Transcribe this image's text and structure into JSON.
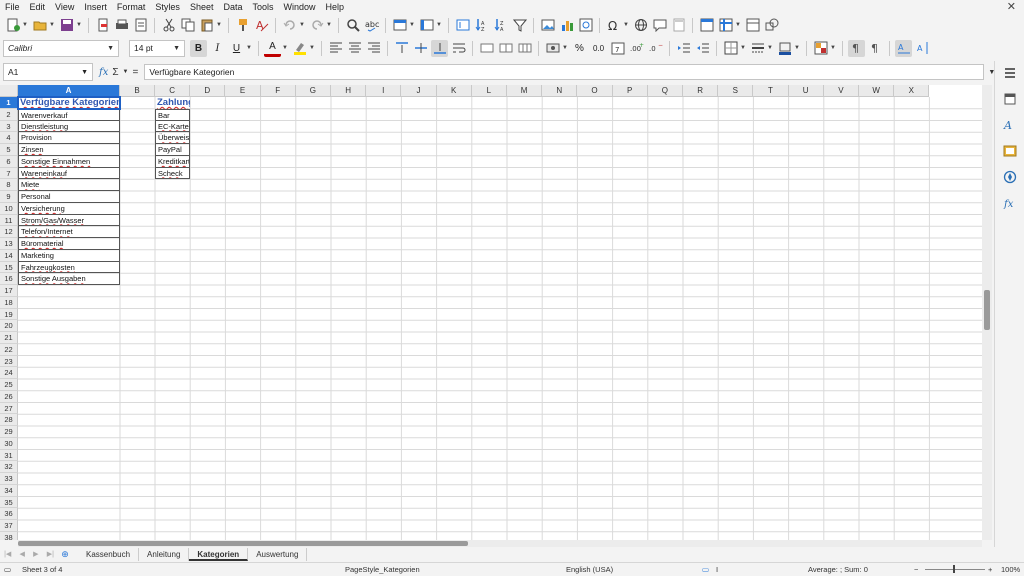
{
  "menu": [
    "File",
    "Edit",
    "View",
    "Insert",
    "Format",
    "Styles",
    "Sheet",
    "Data",
    "Tools",
    "Window",
    "Help"
  ],
  "close_glyph": "✕",
  "font": {
    "name": "Calibri",
    "size": "14 pt"
  },
  "format_buttons": {
    "bold": "B",
    "italic": "I",
    "underline": "U",
    "font_color": "A",
    "percent": "%",
    "decimals": "0.0"
  },
  "namebox": "A1",
  "formula": "Verfügbare Kategorien",
  "formula_symbols": {
    "fx": "fx",
    "sum": "Σ",
    "equals": "="
  },
  "columns": [
    "A",
    "B",
    "C",
    "D",
    "E",
    "F",
    "G",
    "H",
    "I",
    "J",
    "K",
    "L",
    "M",
    "N",
    "O",
    "P",
    "Q",
    "R",
    "S",
    "T",
    "U",
    "V",
    "W",
    "X"
  ],
  "row_count": 38,
  "cells": {
    "A1": "Verfügbare Kategorien",
    "C1": "Zahlungsarten",
    "A": [
      "Warenverkauf",
      "Dienstleistung",
      "Provision",
      "Zinsen",
      "Sonstige Einnahmen",
      "Wareneinkauf",
      "Miete",
      "Personal",
      "Versicherung",
      "Strom/Gas/Wasser",
      "Telefon/Internet",
      "Büromaterial",
      "Marketing",
      "Fahrzeugkosten",
      "Sonstige Ausgaben"
    ],
    "C": [
      "Bar",
      "EC-Karte",
      "Überweisung",
      "PayPal",
      "Kreditkarte",
      "Scheck"
    ]
  },
  "sheet_tabs": [
    "Kassenbuch",
    "Anleitung",
    "Kategorien",
    "Auswertung"
  ],
  "active_tab": "Kategorien",
  "status": {
    "sheet": "Sheet 3 of 4",
    "page_style": "PageStyle_Kategorien",
    "language": "English (USA)",
    "summary": "Average: ; Sum: 0",
    "zoom_minus": "−",
    "zoom_plus": "+",
    "zoom": "100%"
  },
  "colors": {
    "selection": "#2a78d8",
    "heading_text": "#3057b0",
    "spell_underline": "#d02020"
  }
}
